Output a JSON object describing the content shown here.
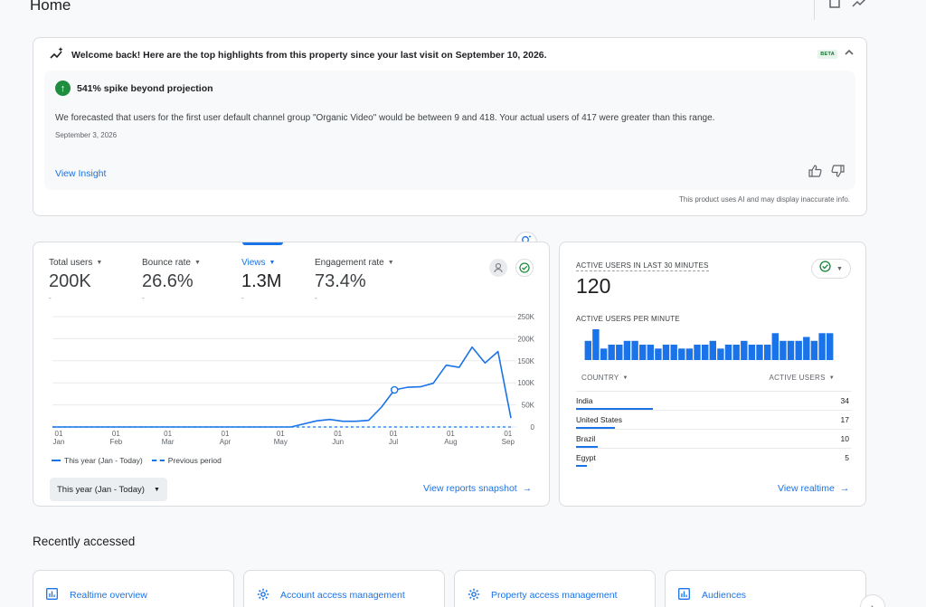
{
  "page": {
    "title": "Home"
  },
  "insight": {
    "header": "Welcome back! Here are the top highlights from this property since your last visit on September 10, 2026.",
    "beta": "BETA",
    "spike_title": "541% spike beyond projection",
    "body": "We forecasted that users for the first user default channel group \"Organic Video\" would be between 9 and 418. Your actual users of 417 were greater than this range.",
    "date": "September 3, 2026",
    "link": "View Insight",
    "ai_note": "This product uses AI and may display inaccurate info."
  },
  "metrics": [
    {
      "label": "Total users",
      "value": "200K",
      "sub": "-"
    },
    {
      "label": "Bounce rate",
      "value": "26.6%",
      "sub": "-"
    },
    {
      "label": "Views",
      "value": "1.3M",
      "sub": "-"
    },
    {
      "label": "Engagement rate",
      "value": "73.4%",
      "sub": "-"
    }
  ],
  "legend": {
    "current": "This year (Jan - Today)",
    "previous": "Previous period"
  },
  "date_range": "This year (Jan - Today)",
  "snapshot_link": "View reports snapshot",
  "chart_data": {
    "type": "line",
    "x_ticks": [
      {
        "day": "01",
        "month": "Jan"
      },
      {
        "day": "01",
        "month": "Feb"
      },
      {
        "day": "01",
        "month": "Mar"
      },
      {
        "day": "01",
        "month": "Apr"
      },
      {
        "day": "01",
        "month": "May"
      },
      {
        "day": "01",
        "month": "Jun"
      },
      {
        "day": "01",
        "month": "Jul"
      },
      {
        "day": "01",
        "month": "Aug"
      },
      {
        "day": "01",
        "month": "Sep"
      }
    ],
    "y_ticks": [
      "250K",
      "200K",
      "150K",
      "100K",
      "50K",
      "0"
    ],
    "ylim": [
      0,
      250000
    ],
    "series": [
      {
        "name": "This year (Jan - Today)",
        "points": [
          [
            "2026-01-01",
            0
          ],
          [
            "2026-05-10",
            0
          ],
          [
            "2026-05-24",
            14000
          ],
          [
            "2026-05-31",
            17000
          ],
          [
            "2026-06-07",
            13000
          ],
          [
            "2026-06-14",
            13000
          ],
          [
            "2026-06-21",
            15000
          ],
          [
            "2026-06-28",
            45000
          ],
          [
            "2026-07-05",
            84000
          ],
          [
            "2026-07-12",
            90000
          ],
          [
            "2026-07-19",
            91000
          ],
          [
            "2026-07-26",
            99000
          ],
          [
            "2026-08-02",
            140000
          ],
          [
            "2026-08-09",
            135000
          ],
          [
            "2026-08-16",
            181000
          ],
          [
            "2026-08-23",
            145000
          ],
          [
            "2026-08-30",
            171000
          ],
          [
            "2026-09-06",
            20000
          ]
        ]
      },
      {
        "name": "Previous period",
        "points": [
          [
            "2026-01-01",
            0
          ],
          [
            "2026-09-06",
            0
          ]
        ]
      }
    ],
    "highlight_point": [
      "2026-07-05",
      84000
    ]
  },
  "realtime": {
    "title": "ACTIVE USERS IN LAST 30 MINUTES",
    "value": "120",
    "per_minute": "ACTIVE USERS PER MINUTE",
    "bars": [
      5,
      8,
      3,
      4,
      4,
      5,
      5,
      4,
      4,
      3,
      4,
      4,
      3,
      3,
      4,
      4,
      5,
      3,
      4,
      4,
      5,
      4,
      4,
      4,
      7,
      5,
      5,
      5,
      6,
      5,
      7,
      7
    ],
    "col_country": "COUNTRY",
    "col_users": "ACTIVE USERS",
    "rows": [
      {
        "country": "India",
        "users": "34",
        "share": 0.28
      },
      {
        "country": "United States",
        "users": "17",
        "share": 0.14
      },
      {
        "country": "Brazil",
        "users": "10",
        "share": 0.08
      },
      {
        "country": "Egypt",
        "users": "5",
        "share": 0.04
      }
    ],
    "link": "View realtime"
  },
  "recent": {
    "title": "Recently accessed",
    "items": [
      {
        "label": "Realtime overview",
        "icon": "bar-chart-icon"
      },
      {
        "label": "Account access management",
        "icon": "gear-icon"
      },
      {
        "label": "Property access management",
        "icon": "gear-icon"
      },
      {
        "label": "Audiences",
        "icon": "bar-chart-icon"
      }
    ]
  },
  "colors": {
    "accent": "#1a73e8",
    "success": "#1e8e3e"
  }
}
